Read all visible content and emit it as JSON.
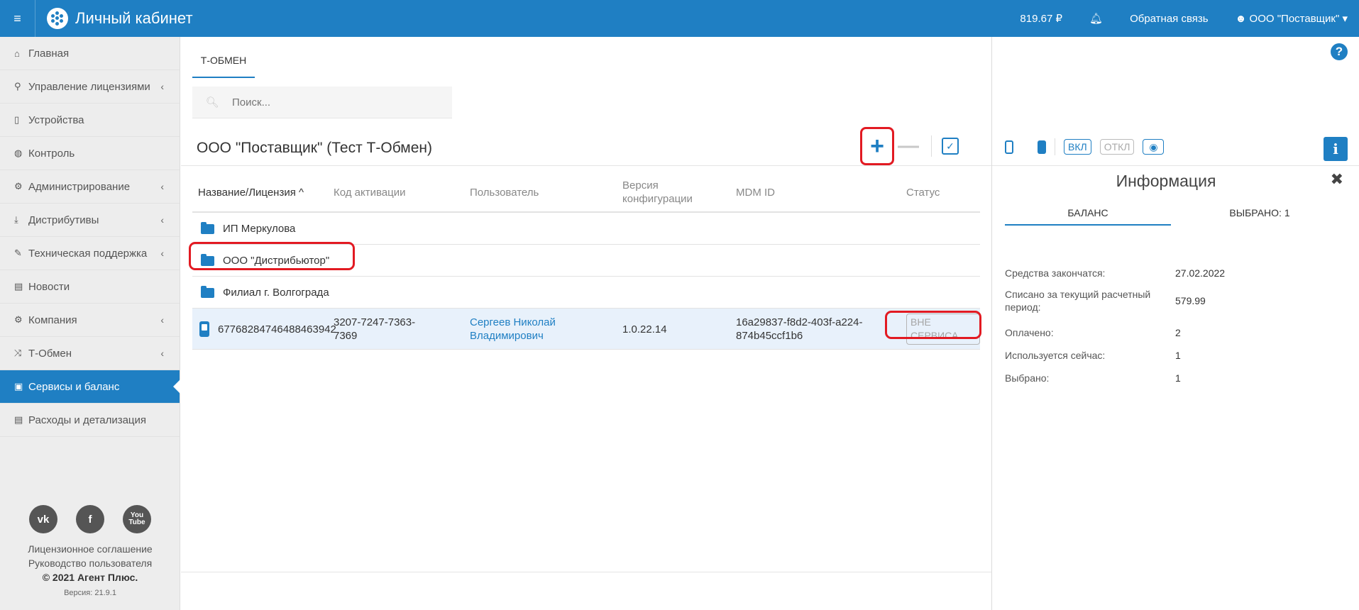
{
  "header": {
    "title": "Личный кабинет",
    "balance": "819.67 ₽",
    "feedback": "Обратная связь",
    "user": "ООО \"Поставщик\""
  },
  "sidebar": {
    "items": [
      {
        "label": "Главная",
        "icon": "home-icon",
        "glyph": "⌂",
        "chev": ""
      },
      {
        "label": "Управление лицензиями",
        "icon": "sitemap-icon",
        "glyph": "⚲",
        "chev": "‹"
      },
      {
        "label": "Устройства",
        "icon": "mobile-icon",
        "glyph": "▯",
        "chev": ""
      },
      {
        "label": "Контроль",
        "icon": "globe-icon",
        "glyph": "◍",
        "chev": ""
      },
      {
        "label": "Администрирование",
        "icon": "cogs-icon",
        "glyph": "⚙",
        "chev": "‹"
      },
      {
        "label": "Дистрибутивы",
        "icon": "download-icon",
        "glyph": "⤓",
        "chev": "‹"
      },
      {
        "label": "Техническая поддержка",
        "icon": "wrench-icon",
        "glyph": "✎",
        "chev": "‹"
      },
      {
        "label": "Новости",
        "icon": "newspaper-icon",
        "glyph": "▤",
        "chev": ""
      },
      {
        "label": "Компания",
        "icon": "gear-icon",
        "glyph": "⚙",
        "chev": "‹"
      },
      {
        "label": "Т-Обмен",
        "icon": "shuffle-icon",
        "glyph": "⤨",
        "chev": "‹"
      },
      {
        "label": "Сервисы и баланс",
        "icon": "money-icon",
        "glyph": "▣",
        "chev": ""
      },
      {
        "label": "Расходы и детализация",
        "icon": "list-icon",
        "glyph": "▤",
        "chev": ""
      }
    ],
    "active_index": 10,
    "social": [
      "vk-icon",
      "facebook-icon",
      "youtube-icon"
    ],
    "footer": {
      "license": "Лицензионное соглашение",
      "guide": "Руководство пользователя",
      "copyright": "© 2021 Агент Плюс.",
      "version": "Версия: 21.9.1"
    }
  },
  "main": {
    "tab": "Т-ОБМЕН",
    "search_placeholder": "Поиск...",
    "org_title": "ООО \"Поставщик\" (Тест Т-Обмен)",
    "columns": {
      "name": "Название/Лицензия ^",
      "code": "Код активации",
      "user": "Пользователь",
      "version": "Версия конфигурации",
      "mdm": "MDM ID",
      "status": "Статус"
    },
    "folders": [
      "ИП Меркулова",
      "ООО \"Дистрибьютор\"",
      "Филиал г. Волгограда"
    ],
    "device": {
      "license": "67768284746488463942",
      "code": "3207-7247-7363-7369",
      "user": "Сергеев Николай Владимирович",
      "version": "1.0.22.14",
      "mdm": "16a29837-f8d2-403f-a224-874b45ccf1b6",
      "status": "ВНЕ СЕРВИСА"
    }
  },
  "panel": {
    "on": "ВКЛ",
    "off": "ОТКЛ",
    "title": "Информация",
    "tab_balance": "БАЛАНС",
    "tab_selected": "ВЫБРАНО: 1",
    "rows": [
      {
        "label": "Средства закончатся:",
        "value": "27.02.2022"
      },
      {
        "label": "Списано за текущий расчетный период:",
        "value": "579.99"
      },
      {
        "label": "Оплачено:",
        "value": "2"
      },
      {
        "label": "Используется сейчас:",
        "value": "1"
      },
      {
        "label": "Выбрано:",
        "value": "1"
      }
    ]
  },
  "colors": {
    "accent": "#1f7fc3",
    "highlight": "#e21a22"
  }
}
